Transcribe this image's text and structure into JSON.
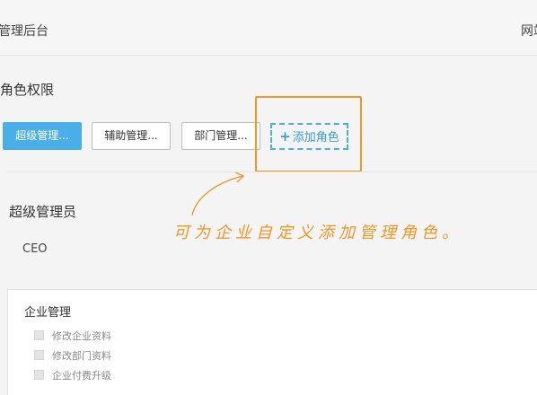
{
  "header": {
    "app_title": "管理后台",
    "top_link": "网站"
  },
  "page": {
    "section_title": "角色权限"
  },
  "roles": [
    {
      "label": "超级管理..."
    },
    {
      "label": "辅助管理..."
    },
    {
      "label": "部门管理..."
    }
  ],
  "add_role": {
    "icon": "plus-icon",
    "label": "添加角色"
  },
  "annotation": {
    "text": "可为企业自定义添加管理角色。"
  },
  "selected_role": {
    "name": "超级管理员",
    "description": "CEO"
  },
  "permissions": {
    "group_title": "企业管理",
    "items": [
      {
        "label": "修改企业资料"
      },
      {
        "label": "修改部门资料"
      },
      {
        "label": "企业付费升级"
      }
    ]
  },
  "colors": {
    "accent": "#4aaee8",
    "annotation": "#f0962a"
  }
}
